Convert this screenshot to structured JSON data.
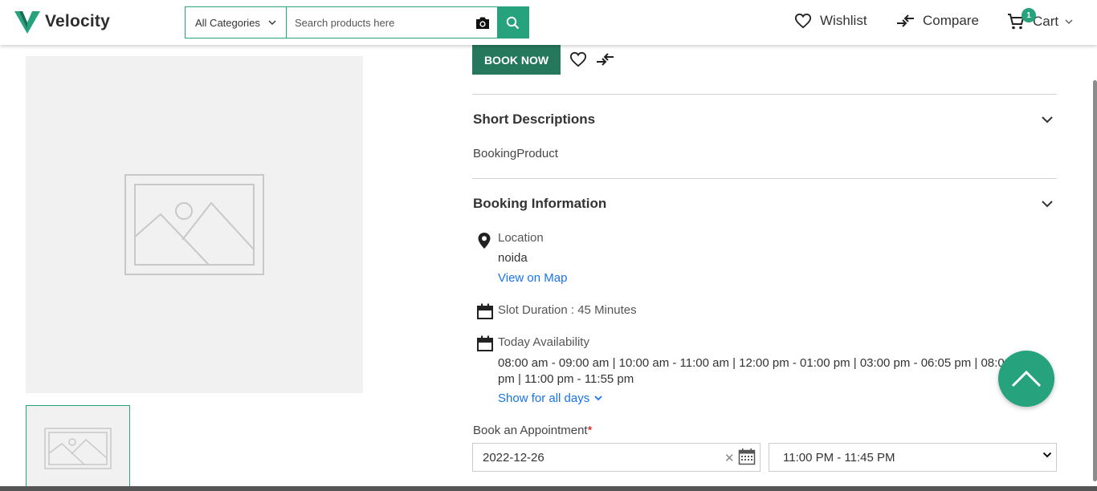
{
  "header": {
    "brand": "Velocity",
    "category_label": "All Categories",
    "search_placeholder": "Search products here",
    "wishlist_label": "Wishlist",
    "compare_label": "Compare",
    "cart_label": "Cart",
    "cart_count": "1"
  },
  "product": {
    "book_now_label": "BOOK NOW",
    "short_desc_title": "Short Descriptions",
    "short_desc_text": "BookingProduct",
    "booking_title": "Booking Information",
    "location_label": "Location",
    "location_value": "noida",
    "map_link": "View on Map",
    "slot_duration": "Slot Duration : 45 Minutes",
    "availability_label": "Today Availability",
    "slots": "08:00 am - 09:00 am | 10:00 am - 11:00 am | 12:00 pm - 01:00 pm | 03:00 pm - 06:05 pm | 08:00 pm | 11:00 pm - 11:55 pm",
    "show_all_days": "Show for all days",
    "appointment_label": "Book an Appointment",
    "required_mark": "*",
    "date_value": "2022-12-26",
    "time_value": "11:00 PM - 11:45 PM"
  },
  "colors": {
    "accent": "#26a37c",
    "book_button": "#26785c",
    "link": "#1a73e8"
  }
}
